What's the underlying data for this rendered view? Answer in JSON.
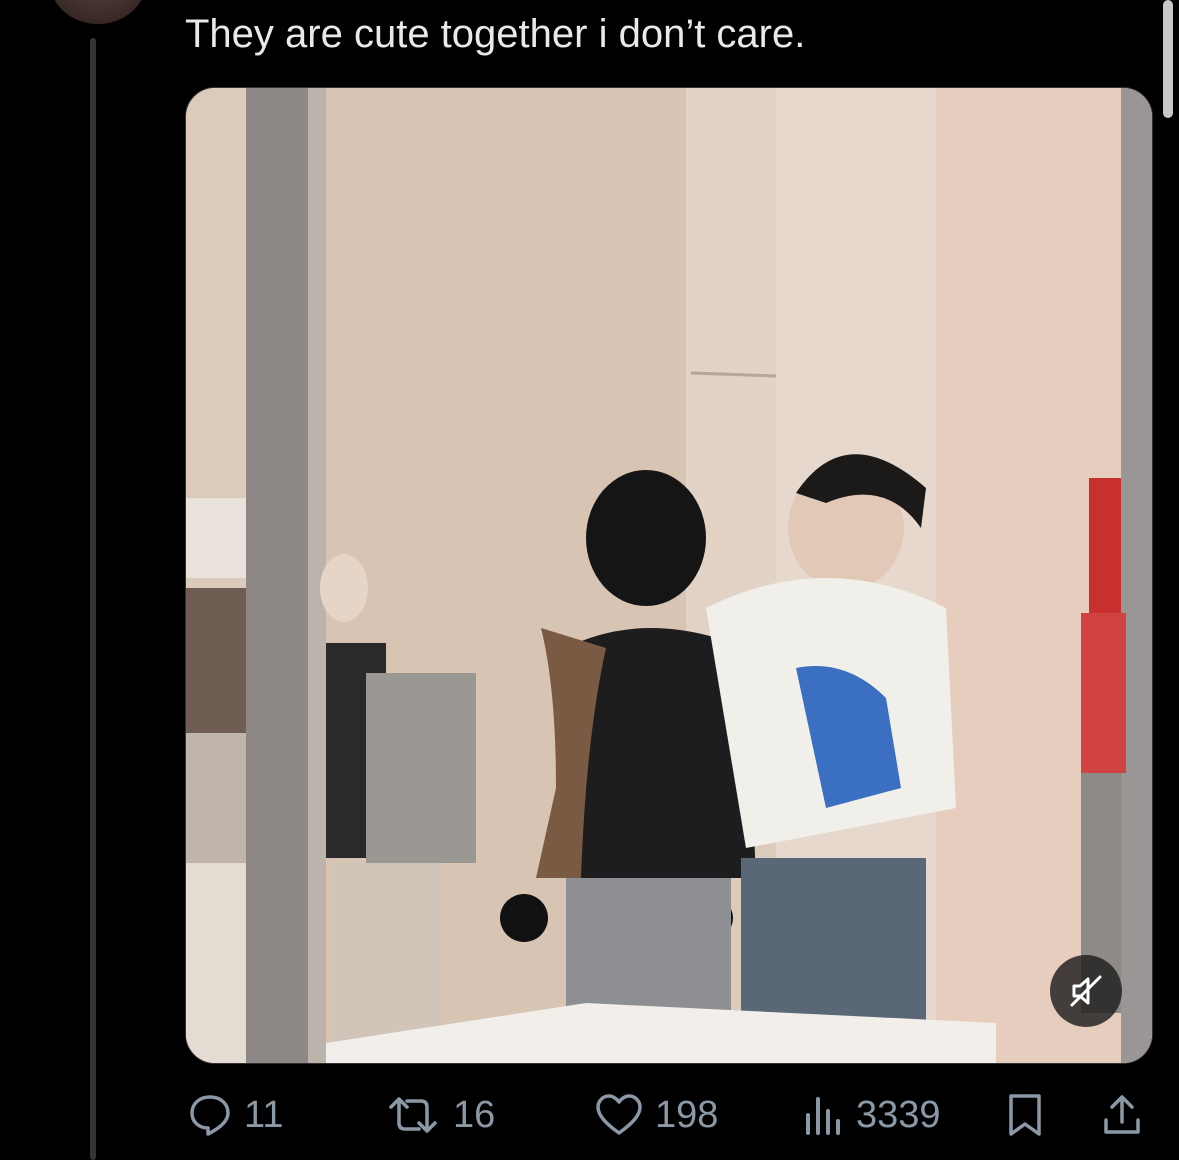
{
  "tweet": {
    "text": "They are cute together i don’t care."
  },
  "media": {
    "description_icon": "video-thumbnail",
    "mute_icon": "volume-muted-icon"
  },
  "actions": {
    "replies": "11",
    "reposts": "16",
    "likes": "198",
    "views": "3339"
  },
  "colors": {
    "background": "#000000",
    "text": "#e7e9ea",
    "muted": "#8b98a5",
    "thread_line": "#333639"
  }
}
